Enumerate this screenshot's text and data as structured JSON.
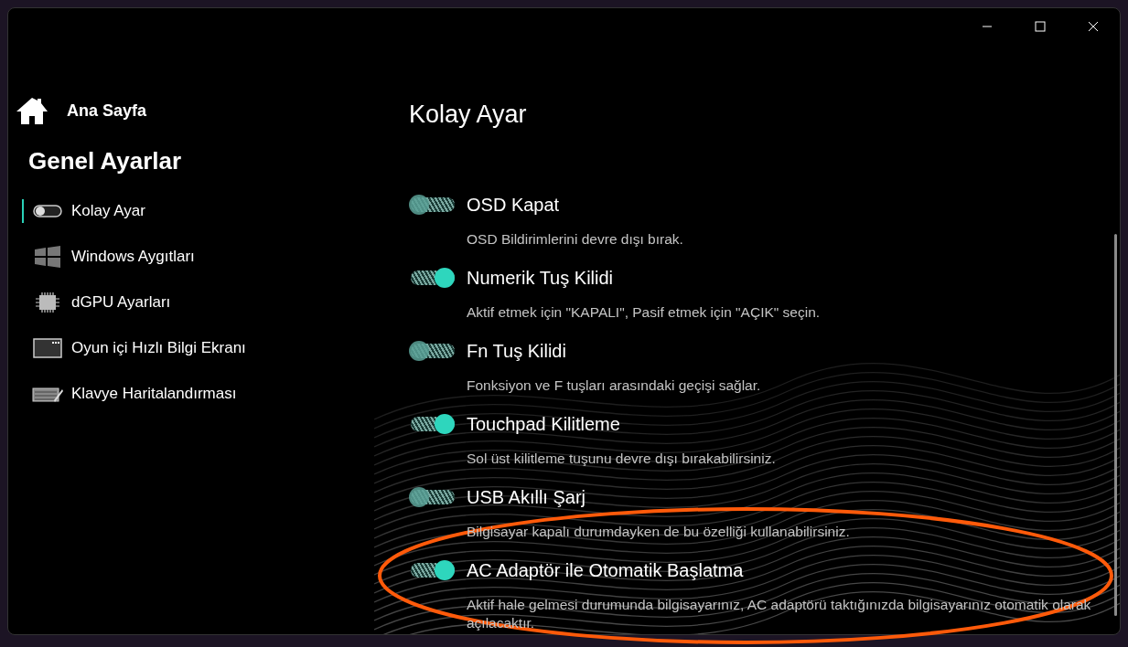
{
  "sidebar": {
    "home": {
      "label": "Ana Sayfa"
    },
    "section_title": "Genel Ayarlar",
    "items": [
      {
        "label": "Kolay Ayar",
        "kind": "toggle",
        "selected": true
      },
      {
        "label": "Windows Aygıtları",
        "kind": "windows",
        "selected": false
      },
      {
        "label": "dGPU Ayarları",
        "kind": "chip",
        "selected": false
      },
      {
        "label": "Oyun içi Hızlı Bilgi Ekranı",
        "kind": "screen",
        "selected": false
      },
      {
        "label": "Klavye Haritalandırması",
        "kind": "keyboard",
        "selected": false
      }
    ]
  },
  "content": {
    "title": "Kolay Ayar",
    "settings": [
      {
        "title": "OSD Kapat",
        "description": "OSD Bildirimlerini devre dışı bırak.",
        "on": false
      },
      {
        "title": "Numerik Tuş Kilidi",
        "description": "Aktif etmek için \"KAPALI\", Pasif etmek için \"AÇIK\" seçin.",
        "on": true
      },
      {
        "title": "Fn Tuş Kilidi",
        "description": "Fonksiyon ve F tuşları arasındaki geçişi sağlar.",
        "on": false
      },
      {
        "title": "Touchpad Kilitleme",
        "description": "Sol üst kilitleme tuşunu devre dışı bırakabilirsiniz.",
        "on": true
      },
      {
        "title": "USB Akıllı Şarj",
        "description": "Bilgisayar kapalı durumdayken de bu özelliği kullanabilirsiniz.",
        "on": false
      },
      {
        "title": "AC Adaptör ile Otomatik Başlatma",
        "description": "Aktif hale gelmesi durumunda bilgisayarınız, AC adaptörü taktığınızda bilgisayarınız otomatik olarak açılacaktır.",
        "on": true
      }
    ]
  }
}
